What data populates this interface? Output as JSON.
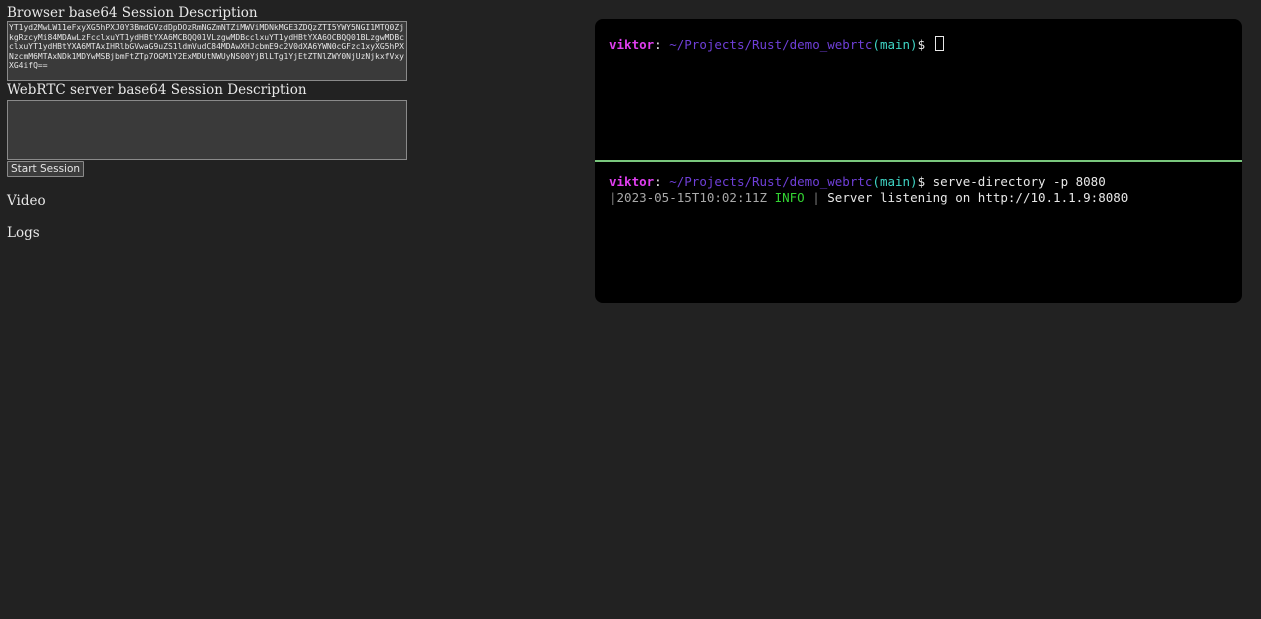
{
  "page": {
    "browser_sdp_label": "Browser base64 Session Description",
    "browser_sdp_value": "YT1yd2MwLW11eFxyXG5hPXJ0Y3BmdGVzdDpDOzRmNGZmNTZiMWViMDNkMGE3ZDQzZTI5YWY5NGI1MTQ0ZjkgRzcyMi84MDAwLzFcclxuYT1ydHBtYXA6MCBQQ01VLzgwMDBcclxuYT1ydHBtYXA6OCBQQ01BLzgwMDBcclxuYT1ydHBtYXA6MTAxIHRlbGVwaG9uZS1ldmVudC84MDAwXHJcbmE9c2V0dXA6YWN0cGFzc1xyXG5hPXNzcmM6MTAxNDk1MDYwMSBjbmFtZTp7OGM1Y2ExMDUtNWUyNS00YjBlLTg1YjEtZTNlZWY0NjUzNjkxfVxyXG4ifQ==",
    "remote_sdp_label": "WebRTC server base64 Session Description",
    "remote_sdp_value": "",
    "start_button_label": "Start Session",
    "video_heading": "Video",
    "logs_heading": "Logs"
  },
  "terminal": {
    "top_pane": {
      "user": "viktor",
      "colon": ":",
      "path": "~/Projects/Rust/demo_webrtc",
      "branch": "(main)",
      "dollar": "$"
    },
    "bottom_pane": {
      "user": "viktor",
      "colon": ":",
      "path": "~/Projects/Rust/demo_webrtc",
      "branch": "(main)",
      "dollar": "$",
      "command": "serve-directory -p 8080",
      "log_pipe_open": "|",
      "log_timestamp": "2023-05-15T10:02:11Z",
      "log_level": "INFO",
      "log_pipe_sep": "|",
      "log_message": "Server listening on http://10.1.1.9:8080"
    },
    "colors": {
      "background": "#000000",
      "divider": "#79c77d",
      "user": "#e03ef0",
      "path": "#6f3fd8",
      "branch": "#3fd6c6",
      "info": "#32d232"
    }
  },
  "icons": {
    "terminal_cursor": "block-cursor-icon"
  }
}
